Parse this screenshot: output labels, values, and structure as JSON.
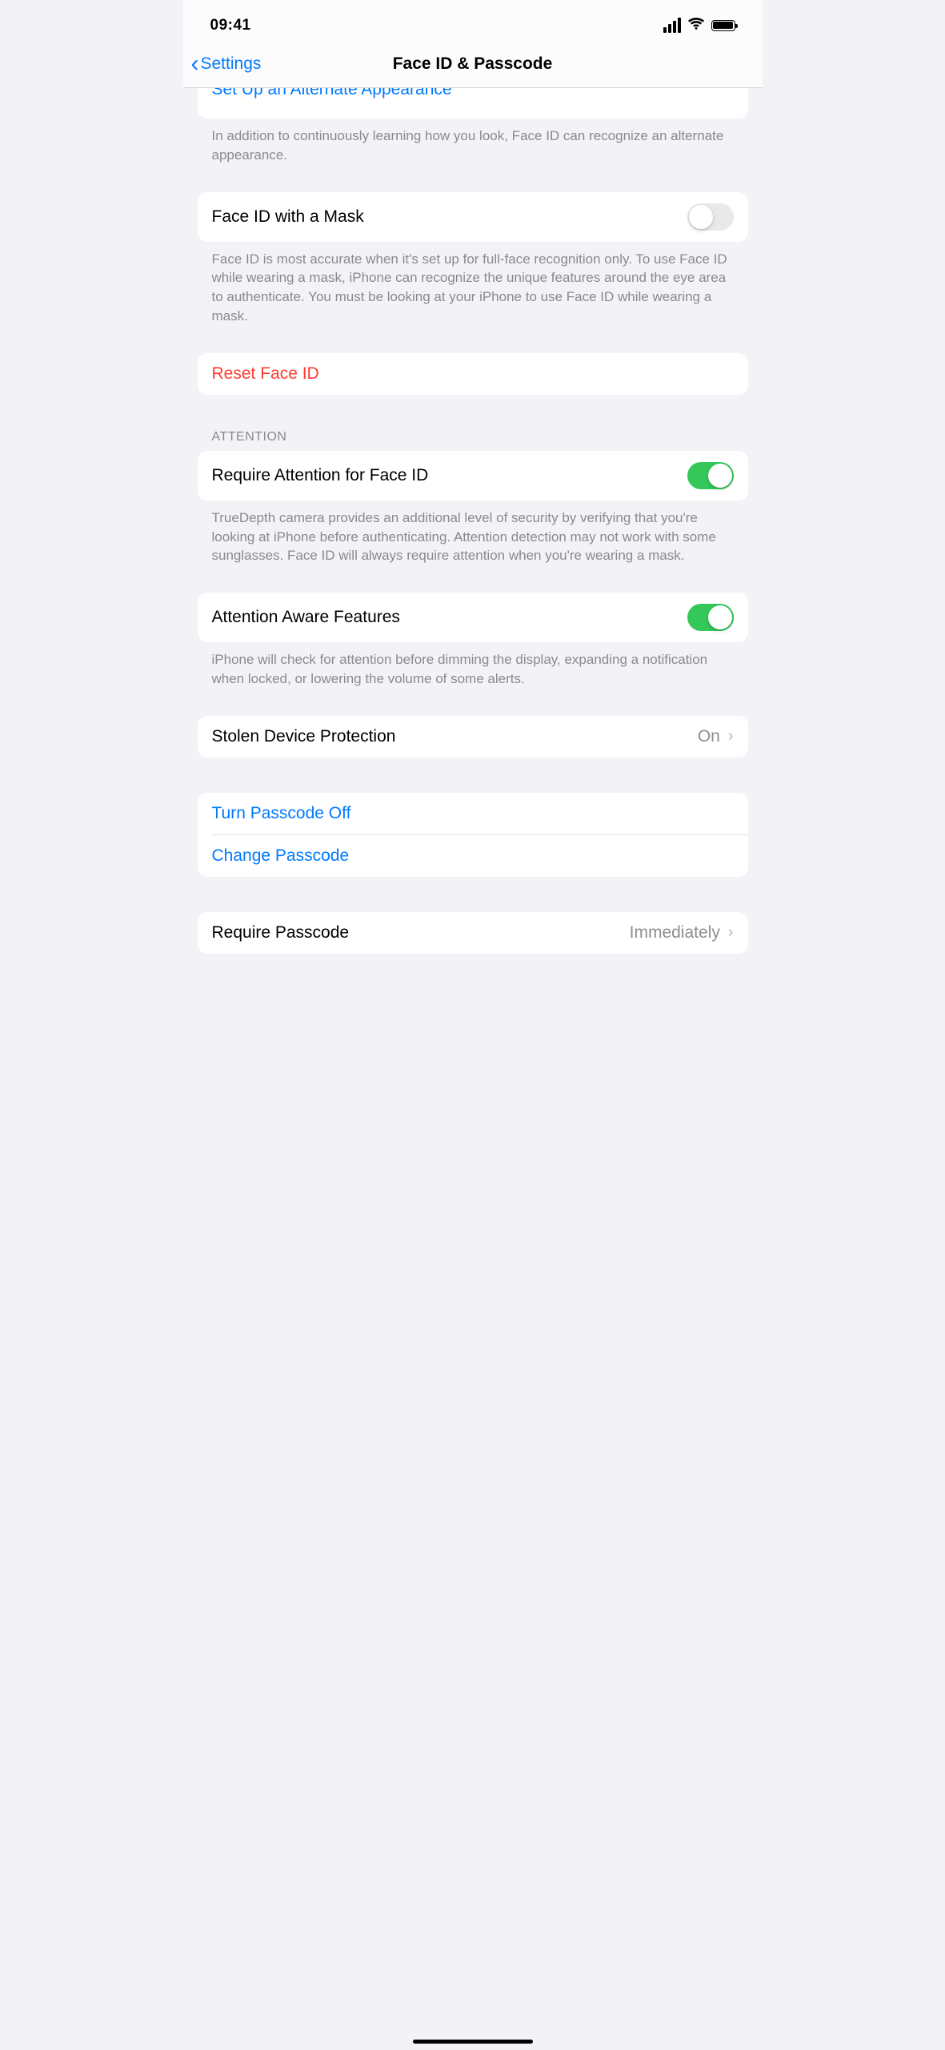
{
  "status": {
    "time": "09:41"
  },
  "nav": {
    "back_label": "Settings",
    "title": "Face ID & Passcode"
  },
  "alternate": {
    "peek_label": "Set Up an Alternate Appearance",
    "footer": "In addition to continuously learning how you look, Face ID can recognize an alternate appearance."
  },
  "mask": {
    "label": "Face ID with a Mask",
    "enabled": false,
    "footer": "Face ID is most accurate when it's set up for full-face recognition only. To use Face ID while wearing a mask, iPhone can recognize the unique features around the eye area to authenticate. You must be looking at your iPhone to use Face ID while wearing a mask."
  },
  "reset": {
    "label": "Reset Face ID"
  },
  "attention": {
    "header": "Attention",
    "require_label": "Require Attention for Face ID",
    "require_enabled": true,
    "require_footer": "TrueDepth camera provides an additional level of security by verifying that you're looking at iPhone before authenticating. Attention detection may not work with some sunglasses. Face ID will always require attention when you're wearing a mask.",
    "aware_label": "Attention Aware Features",
    "aware_enabled": true,
    "aware_footer": "iPhone will check for attention before dimming the display, expanding a notification when locked, or lowering the volume of some alerts."
  },
  "stolen": {
    "label": "Stolen Device Protection",
    "value": "On"
  },
  "passcode": {
    "turn_off_label": "Turn Passcode Off",
    "change_label": "Change Passcode",
    "require_label": "Require Passcode",
    "require_value": "Immediately"
  }
}
